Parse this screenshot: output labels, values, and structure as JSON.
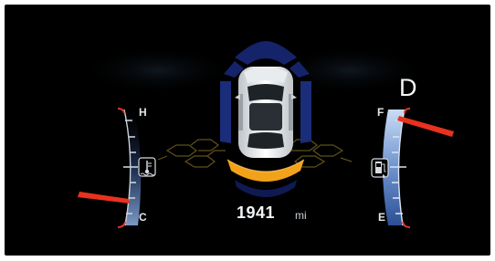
{
  "cluster": {
    "gear": "D",
    "odometer": {
      "value": "1941",
      "unit": "mi"
    },
    "temperature_gauge": {
      "high_label": "H",
      "low_label": "C",
      "level_fraction": 0.18,
      "icon": "coolant-temperature-icon"
    },
    "fuel_gauge": {
      "full_label": "F",
      "empty_label": "E",
      "level_fraction": 0.85,
      "icon": "fuel-pump-icon"
    },
    "parking_sensor": {
      "icon": "car-top-view-icon",
      "rear_alert": "active",
      "rear_alert_color": "#f2a21a"
    },
    "colors": {
      "needle": "#e8321f",
      "gauge_fill": "#4a73b8",
      "zone_blue": "#14236a",
      "background": "#000000"
    }
  }
}
